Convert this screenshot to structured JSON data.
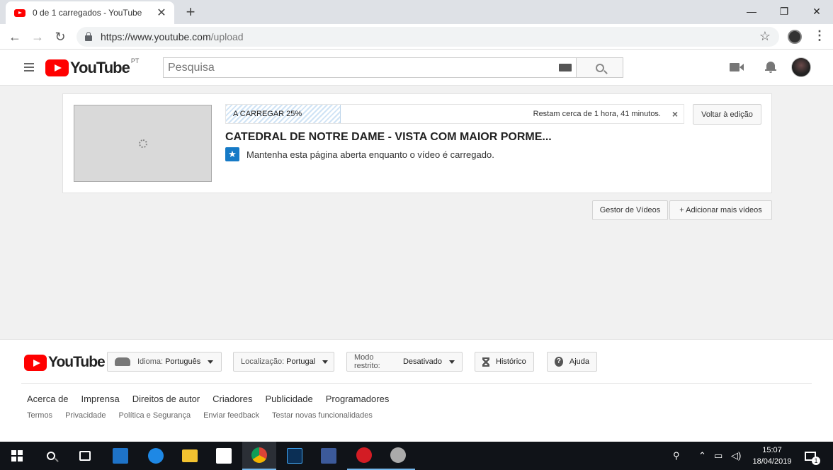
{
  "browser": {
    "tab_title": "0 de 1 carregados - YouTube",
    "tab_close": "✕",
    "new_tab": "+",
    "url_host": "https://www.youtube.com",
    "url_path": "/upload",
    "win_min": "—",
    "win_restore": "❐",
    "win_close": "✕",
    "back": "←",
    "forward": "→",
    "reload": "↻",
    "star": "☆",
    "menu": "⋮"
  },
  "header": {
    "logo_text": "YouTube",
    "country": "PT",
    "search_placeholder": "Pesquisa"
  },
  "upload": {
    "status_label": "A CARREGAR 25%",
    "progress": 0.25,
    "remaining": "Restam cerca de 1 hora, 41 minutos.",
    "close": "×",
    "back_button": "Voltar à edição",
    "video_title": "CATEDRAL DE NOTRE DAME - VISTA COM MAIOR PORME...",
    "info_icon": "★",
    "info_text": "Mantenha esta página aberta enquanto o vídeo é carregado."
  },
  "actions": {
    "video_manager": "Gestor de Vídeos",
    "add_more": "+ Adicionar mais vídeos"
  },
  "footer": {
    "logo_text": "YouTube",
    "language_label": "Idioma:",
    "language_value": "Português",
    "location_label": "Localização:",
    "location_value": "Portugal",
    "restricted_label": "Modo restrito:",
    "restricted_value": "Desativado",
    "history": "Histórico",
    "help": "Ajuda",
    "help_icon": "?",
    "links_primary": [
      "Acerca de",
      "Imprensa",
      "Direitos de autor",
      "Criadores",
      "Publicidade",
      "Programadores"
    ],
    "links_secondary": [
      "Termos",
      "Privacidade",
      "Política e Segurança",
      "Enviar feedback",
      "Testar novas funcionalidades"
    ]
  },
  "taskbar": {
    "time": "15:07",
    "date": "18/04/2019",
    "notification_count": "1"
  }
}
